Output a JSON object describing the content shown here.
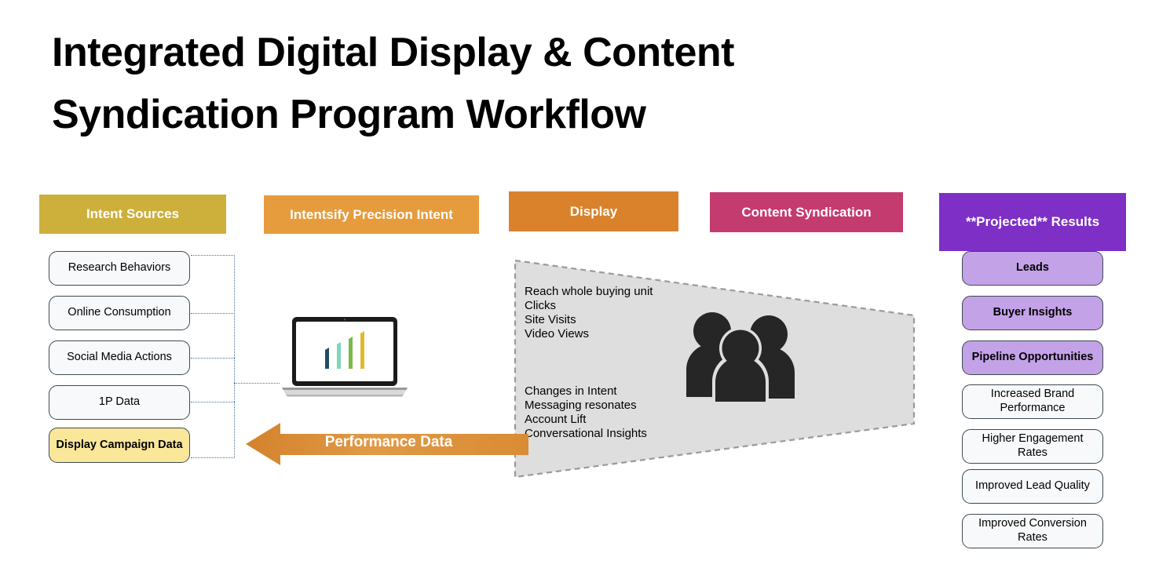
{
  "page": {
    "title": "Integrated Digital Display & Content Syndication Program Workflow"
  },
  "columns": {
    "intent_sources": {
      "header": "Intent Sources",
      "header_color": "#cdaf3c",
      "items": [
        {
          "label": "Research Behaviors",
          "style": "default"
        },
        {
          "label": "Online Consumption",
          "style": "default"
        },
        {
          "label": "Social Media  Actions",
          "style": "default"
        },
        {
          "label": "1P Data",
          "style": "default"
        },
        {
          "label": "Display Campaign Data",
          "style": "highlight-yellow"
        }
      ]
    },
    "precision_intent": {
      "header": "Intentsify Precision Intent",
      "header_color": "#e69c3d",
      "icon": "laptop-bar-chart-icon",
      "bar_colors": [
        "#1f4e66",
        "#7dd6b8",
        "#7db84a",
        "#e0b92e"
      ]
    },
    "display": {
      "header": "Display",
      "header_color": "#d9822b",
      "metrics": "Reach whole buying unit\nClicks\nSite Visits\nVideo Views"
    },
    "content_syndication": {
      "header": "Content Syndication",
      "header_color": "#c43b6f",
      "metrics": "Changes in Intent\nMessaging resonates\nAccount Lift\nConversational Insights",
      "icon": "people-group-icon"
    },
    "projected_results": {
      "header": "**Projected** Results",
      "header_color": "#7d2fc6",
      "items": [
        {
          "label": "Leads",
          "style": "highlight-purple"
        },
        {
          "label": "Buyer Insights",
          "style": "highlight-purple"
        },
        {
          "label": "Pipeline Opportunities",
          "style": "highlight-purple"
        },
        {
          "label": "Increased Brand Performance",
          "style": "default"
        },
        {
          "label": "Higher Engagement Rates",
          "style": "default"
        },
        {
          "label": "Improved Lead Quality",
          "style": "default"
        },
        {
          "label": "Improved Conversion Rates",
          "style": "default"
        }
      ]
    }
  },
  "feedback_arrow": {
    "label": "Performance Data",
    "color": "#d9822b",
    "direction": "left"
  },
  "trapezoid": {
    "fill": "#dedede",
    "stroke": "#9a9a9a"
  }
}
